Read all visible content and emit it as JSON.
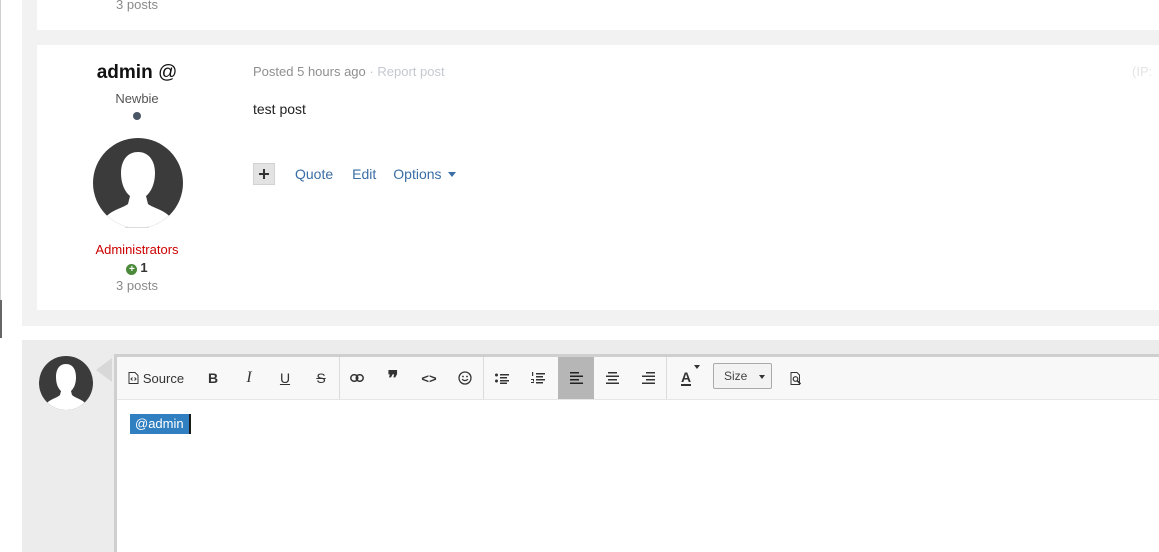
{
  "previous_post": {
    "posts_count": "3 posts"
  },
  "post": {
    "author": {
      "name": "admin",
      "mention_symbol": "@",
      "rank": "Newbie",
      "group": "Administrators",
      "reputation_icon": "plus-circle-icon",
      "reputation": "1",
      "posts_count": "3 posts"
    },
    "meta": {
      "posted_label": "Posted",
      "time": "5 hours ago",
      "separator": "·",
      "report_label": "Report post",
      "ip_label": "(IP:"
    },
    "content": "test post",
    "actions": {
      "multiquote_icon": "plus-icon",
      "quote_label": "Quote",
      "edit_label": "Edit",
      "options_label": "Options"
    }
  },
  "reply": {
    "toolbar": {
      "source_label": "Source",
      "bold": "B",
      "italic": "I",
      "underline": "U",
      "strike": "S",
      "quote_glyph": "❞",
      "code_glyph": "<>",
      "font_color_glyph": "A",
      "size_label": "Size"
    },
    "mention_text": "@admin"
  },
  "colors": {
    "group_color": "#cc0000",
    "link_color": "#3a6ea5",
    "mention_bg": "#2f7fc1",
    "reputation_green": "#4b8a3a"
  }
}
